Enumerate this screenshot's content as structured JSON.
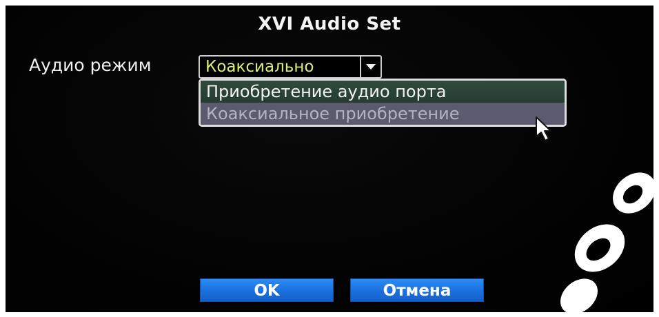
{
  "dialog": {
    "title": "XVI Audio Set"
  },
  "audio_mode": {
    "label": "Аудио режим",
    "selected_value": "Коаксиально"
  },
  "dropdown": {
    "options": [
      "Приобретение аудио порта",
      "Коаксиальное приобретение"
    ],
    "highlighted_index": 1
  },
  "buttons": {
    "ok_label": "OK",
    "cancel_label": "Отмена"
  },
  "colors": {
    "background": "#000000",
    "selected_text": "#d8ee7a",
    "button": "#1a6fe0",
    "option_hover": "#5b5a6e"
  },
  "icons": {
    "dropdown_arrow": "chevron-down-icon",
    "cursor": "mouse-pointer-icon"
  }
}
